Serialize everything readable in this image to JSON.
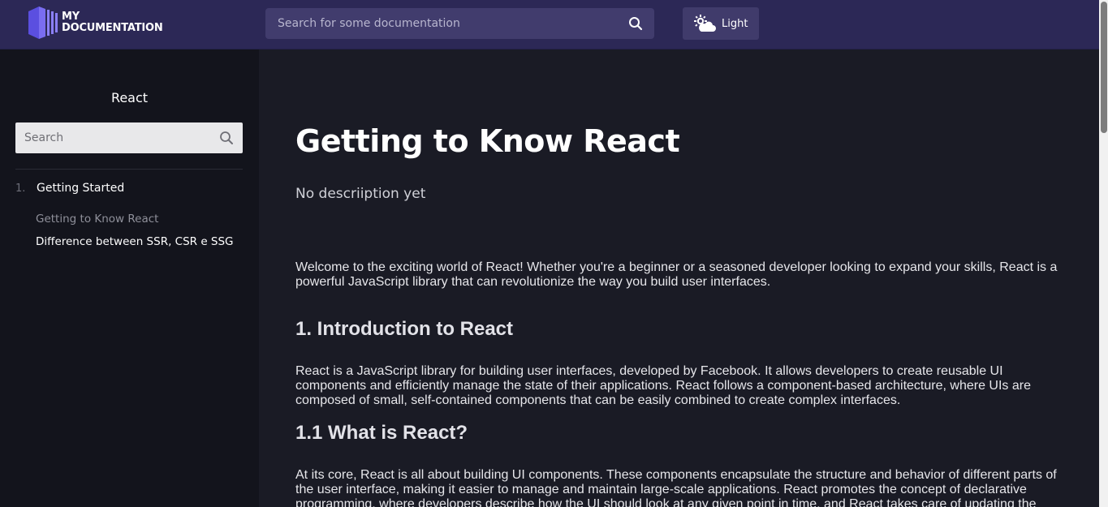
{
  "header": {
    "logo": {
      "line1": "MY",
      "line2": "DOCUMENTATION"
    },
    "search": {
      "placeholder": "Search for some documentation",
      "value": ""
    },
    "theme_button": {
      "label": "Light",
      "icon": "weather-cloud-sun-icon"
    }
  },
  "sidebar": {
    "title": "React",
    "search": {
      "placeholder": "Search",
      "value": ""
    },
    "sections": [
      {
        "number": "1.",
        "title": "Getting Started",
        "items": [
          {
            "label": "Getting to Know React",
            "active": true
          },
          {
            "label": "Difference between SSR, CSR e SSG",
            "active": false
          }
        ]
      }
    ]
  },
  "article": {
    "title": "Getting to Know React",
    "description": "No descriiption yet",
    "blocks": [
      {
        "type": "paragraph",
        "text": "Welcome to the exciting world of React! Whether you're a beginner or a seasoned developer looking to expand your skills, React is a powerful JavaScript library that can revolutionize the way you build user interfaces."
      },
      {
        "type": "heading",
        "text": "1. Introduction to React"
      },
      {
        "type": "paragraph",
        "text": "React is a JavaScript library for building user interfaces, developed by Facebook. It allows developers to create reusable UI components and efficiently manage the state of their applications. React follows a component-based architecture, where UIs are composed of small, self-contained components that can be easily combined to create complex interfaces."
      },
      {
        "type": "heading",
        "text": "1.1 What is React?"
      },
      {
        "type": "paragraph",
        "text": "At its core, React is all about building UI components. These components encapsulate the structure and behavior of different parts of the user interface, making it easier to manage and maintain large-scale applications. React promotes the concept of declarative programming, where developers describe how the UI should look at any given point in time, and React takes care of updating the"
      }
    ]
  },
  "colors": {
    "header_bg": "#2c2856",
    "sidebar_bg": "#13141c",
    "main_bg": "#1a1b25",
    "logo_accent": "#5f4fd8"
  }
}
